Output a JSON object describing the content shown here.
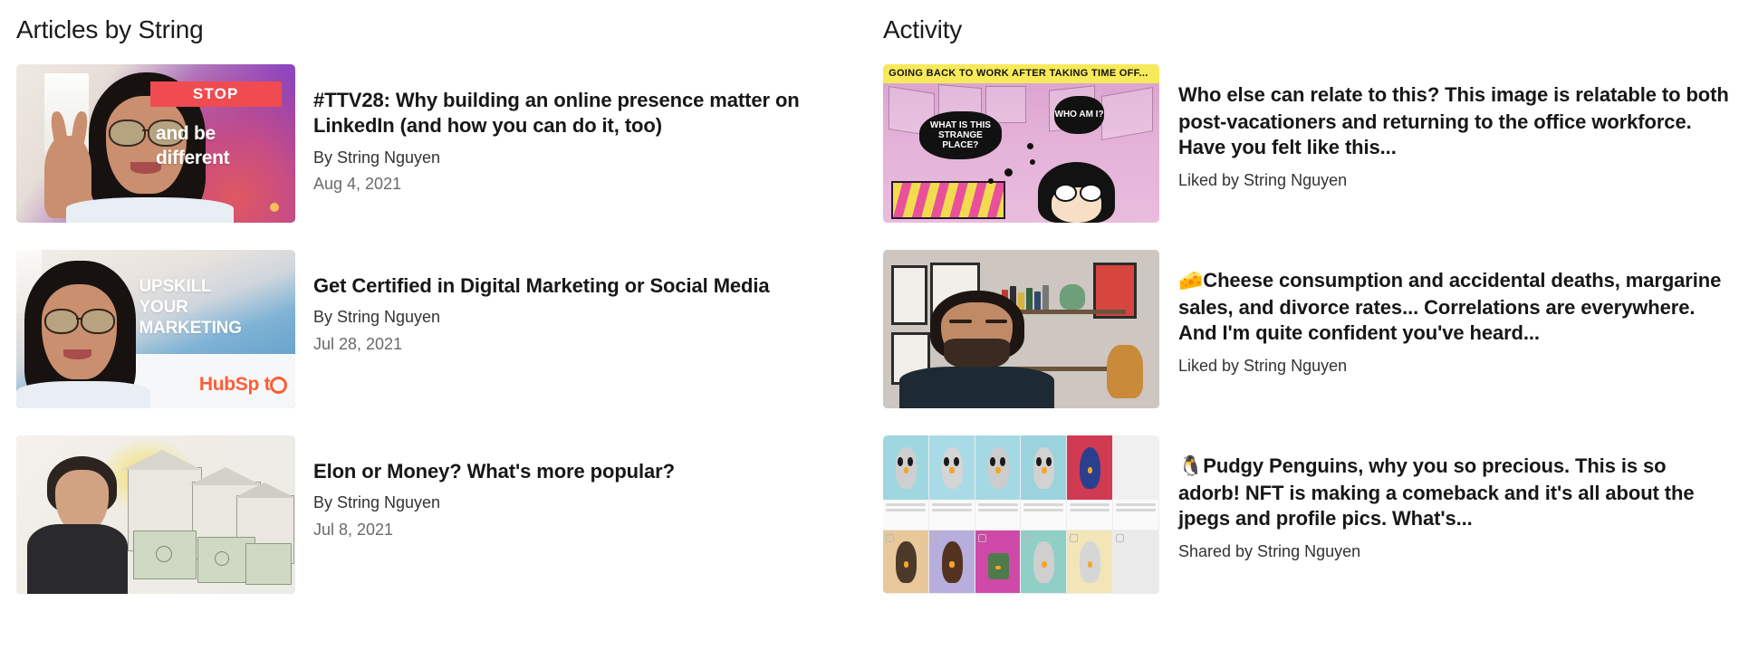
{
  "sections": {
    "articles": {
      "title": "Articles by String",
      "items": [
        {
          "title": "#TTV28: Why building an online presence matter on LinkedIn (and how you can do it, too)",
          "author": "By String Nguyen",
          "date": "Aug 4, 2021",
          "thumbnail_name": "article-thumbnail-stop-and-be-different",
          "thumbnail_text": {
            "badge": "STOP",
            "line1": "and be",
            "line2": "different"
          }
        },
        {
          "title": "Get Certified in Digital Marketing or Social Media",
          "author": "By String Nguyen",
          "date": "Jul 28, 2021",
          "thumbnail_name": "article-thumbnail-upskill-your-marketing",
          "thumbnail_text": {
            "line1": "UPSKILL",
            "line2": "YOUR",
            "line3": "MARKETING",
            "brand": "HubSp t"
          }
        },
        {
          "title": "Elon or Money? What's more popular?",
          "author": "By String Nguyen",
          "date": "Jul 8, 2021",
          "thumbnail_name": "article-thumbnail-elon-or-money",
          "thumbnail_text": {}
        }
      ]
    },
    "activity": {
      "title": "Activity",
      "items": [
        {
          "emoji": "",
          "text": "Who else can relate to this?  This image is relatable to both post-vacationers and returning to the office workforce. Have you felt like this...",
          "meta": "Liked by String Nguyen",
          "thumbnail_name": "activity-thumbnail-back-to-work-comic",
          "thumbnail_text": {
            "banner": "GOING BACK TO WORK AFTER TAKING TIME OFF...",
            "bubble1": "WHAT IS THIS STRANGE PLACE?",
            "bubble2": "WHO AM I?"
          }
        },
        {
          "emoji": "🧀",
          "text": "Cheese consumption and accidental deaths, margarine sales, and divorce rates... Correlations are everywhere. And I'm quite confident you've heard...",
          "meta": "Liked by String Nguyen",
          "thumbnail_name": "activity-thumbnail-man-in-room",
          "thumbnail_text": {}
        },
        {
          "emoji": "🐧",
          "text": "Pudgy Penguins, why you so precious. This is so adorb! NFT is making a comeback and it's all about the jpegs and profile pics. What's...",
          "meta": "Shared by String Nguyen",
          "thumbnail_name": "activity-thumbnail-pudgy-penguins-grid",
          "thumbnail_text": {}
        }
      ]
    }
  },
  "colors": {
    "background": "#ffffff",
    "heading": "#1b1b1b",
    "title": "#171717",
    "author": "#333333",
    "date": "#6a6a6a",
    "accent_red": "#ef4b51",
    "accent_orange": "#ff5c35"
  }
}
